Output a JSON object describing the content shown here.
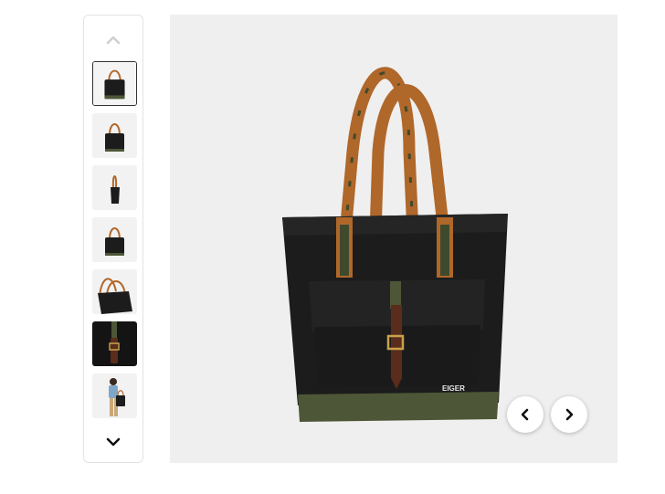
{
  "gallery": {
    "thumbnails": [
      {
        "name": "front",
        "selected": true
      },
      {
        "name": "front-alt",
        "selected": false
      },
      {
        "name": "side",
        "selected": false
      },
      {
        "name": "back",
        "selected": false
      },
      {
        "name": "angle",
        "selected": false
      },
      {
        "name": "detail-strap",
        "selected": false
      },
      {
        "name": "model-wear",
        "selected": false
      }
    ],
    "main_image": {
      "brand_text": "EIGER"
    },
    "icons": {
      "scroll_up": "chevron-up-icon",
      "scroll_down": "chevron-down-icon",
      "previous": "chevron-left-icon",
      "next": "chevron-right-icon"
    },
    "colors": {
      "bag_body": "#1c1c1c",
      "bag_base": "#4d5636",
      "strap": "#b0672a",
      "buckle": "#5a2c1c",
      "background": "#efefef"
    }
  }
}
